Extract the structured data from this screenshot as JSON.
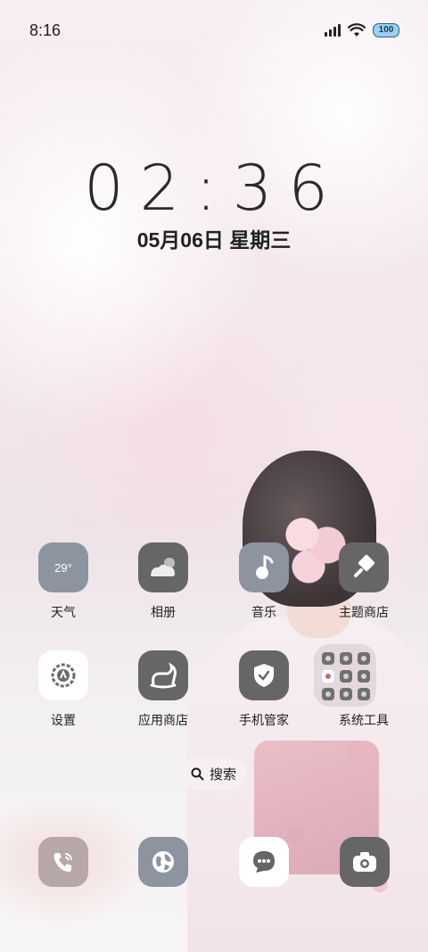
{
  "status_bar": {
    "time": "8:16",
    "battery": "100",
    "icons": [
      "signal-icon",
      "wifi-icon",
      "battery-icon"
    ]
  },
  "clock": {
    "time": "02:36",
    "date": "05月06日 星期三"
  },
  "apps_row1": [
    {
      "label": "天气",
      "icon": "weather-icon",
      "badge": "29°"
    },
    {
      "label": "相册",
      "icon": "gallery-icon"
    },
    {
      "label": "音乐",
      "icon": "music-icon"
    },
    {
      "label": "主题商店",
      "icon": "theme-store-icon"
    }
  ],
  "apps_row2": [
    {
      "label": "设置",
      "icon": "settings-icon"
    },
    {
      "label": "应用商店",
      "icon": "app-store-icon"
    },
    {
      "label": "手机管家",
      "icon": "phone-manager-icon"
    },
    {
      "label": "系统工具",
      "icon": "folder-icon"
    }
  ],
  "search": {
    "label": "搜索"
  },
  "dock": [
    {
      "icon": "phone-icon"
    },
    {
      "icon": "browser-icon"
    },
    {
      "icon": "messages-icon"
    },
    {
      "icon": "camera-icon"
    }
  ],
  "colors": {
    "icon_gray": "#666668",
    "icon_grayblue": "#8c949f",
    "icon_white": "#ffffff",
    "icon_mauve": "#b7a7a8"
  }
}
